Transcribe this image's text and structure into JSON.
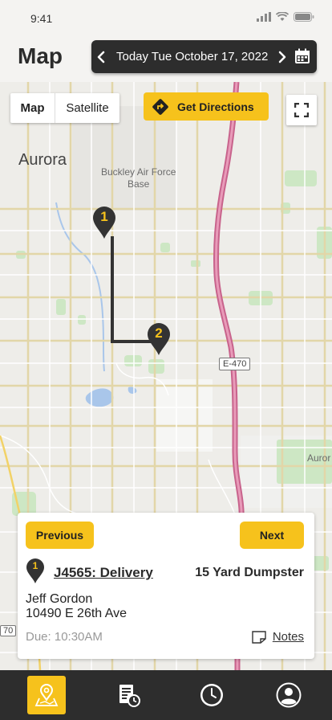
{
  "status": {
    "time": "9:41"
  },
  "header": {
    "title": "Map",
    "date_label": "Today Tue October 17, 2022",
    "prev_icon": "chevron-left-icon",
    "next_icon": "chevron-right-icon",
    "calendar_icon": "calendar-icon"
  },
  "map": {
    "toggle": {
      "map_label": "Map",
      "satellite_label": "Satellite",
      "selected": "Map"
    },
    "directions_label": "Get Directions",
    "labels": {
      "aurora": "Aurora",
      "buckley_line1": "Buckley Air Force",
      "buckley_line2": "Base",
      "aurora_east": "Auror",
      "highway_e470": "E-470",
      "highway_70": "70"
    },
    "pins": [
      {
        "number": "1"
      },
      {
        "number": "2"
      }
    ]
  },
  "card": {
    "prev_label": "Previous",
    "next_label": "Next",
    "stop_number": "1",
    "job_id": "J4565: Delivery",
    "job_type": "15 Yard Dumpster",
    "customer_name": "Jeff Gordon",
    "address": "10490 E 26th Ave",
    "due": "Due: 10:30AM",
    "notes_label": "Notes"
  },
  "nav": {
    "items": [
      {
        "name": "map",
        "icon": "map-pin-icon",
        "active": true
      },
      {
        "name": "jobs",
        "icon": "job-list-clock-icon",
        "active": false
      },
      {
        "name": "history",
        "icon": "clock-icon",
        "active": false
      },
      {
        "name": "profile",
        "icon": "user-icon",
        "active": false
      }
    ]
  },
  "colors": {
    "accent": "#f6c21c",
    "dark": "#2d2d2d",
    "route": "#333333",
    "highway": "#d9739b"
  }
}
